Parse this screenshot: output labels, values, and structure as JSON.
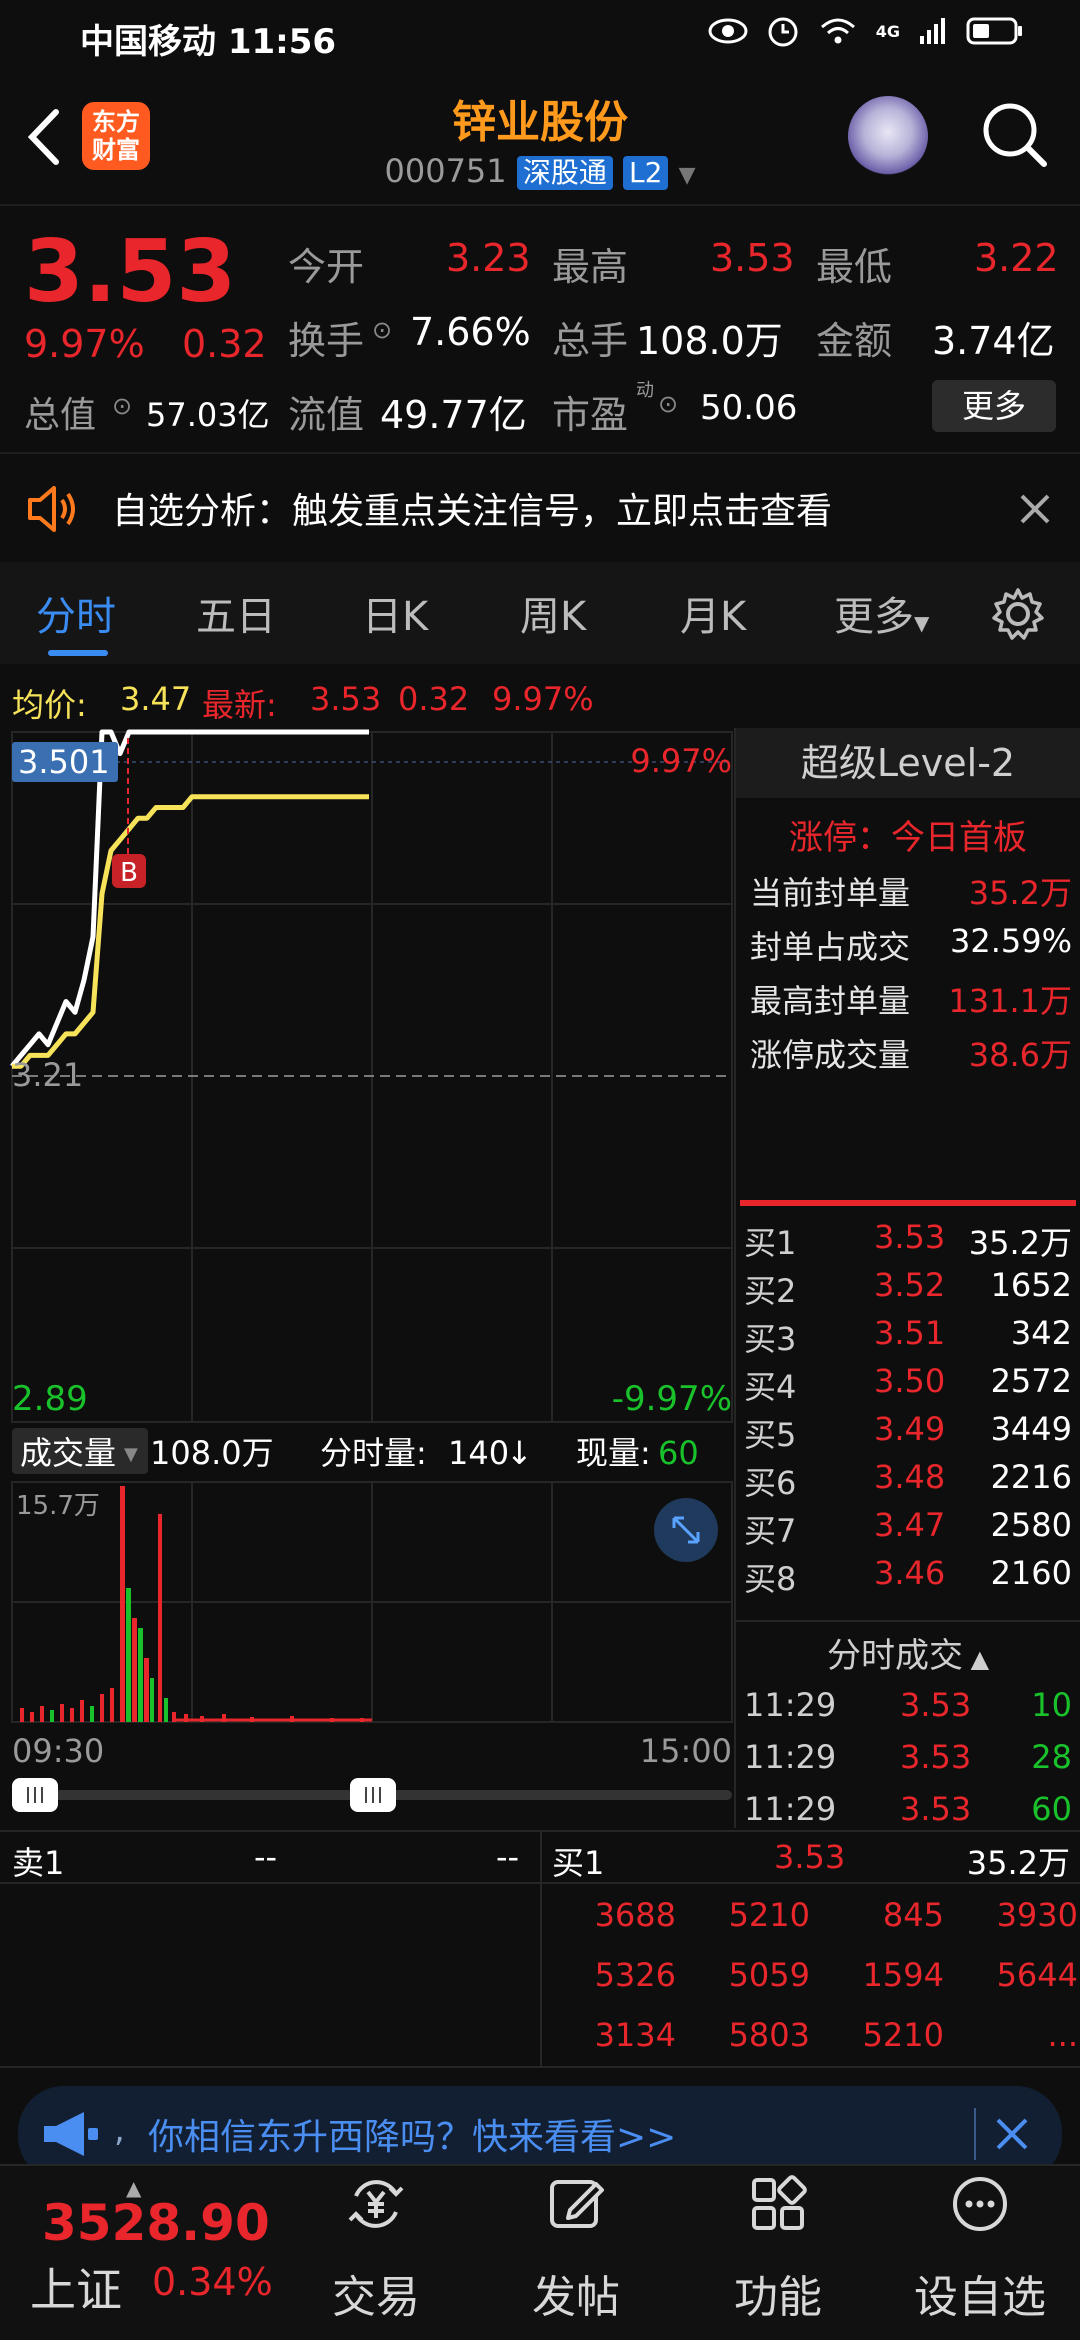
{
  "status_bar": {
    "carrier_time": "中国移动 11:56",
    "network": "4G"
  },
  "header": {
    "logo_text": "东方财富",
    "stock_name": "锌业股份",
    "stock_code": "000751",
    "tag_sz": "深股通",
    "tag_l2": "L2"
  },
  "quote": {
    "price": "3.53",
    "pct": "9.97%",
    "change": "0.32",
    "open_label": "今开",
    "open": "3.23",
    "high_label": "最高",
    "high": "3.53",
    "low_label": "最低",
    "low": "3.22",
    "turnover_label": "换手",
    "turnover": "7.66%",
    "volume_label": "总手",
    "volume": "108.0万",
    "amount_label": "金额",
    "amount": "3.74亿",
    "mcap_label": "总值",
    "mcap": "57.03亿",
    "float_label": "流值",
    "float": "49.77亿",
    "pe_label": "市盈",
    "pe_super": "动",
    "pe": "50.06",
    "more_button": "更多"
  },
  "notice": {
    "text": "自选分析：触发重点关注信号，立即点击查看"
  },
  "tabs": [
    "分时",
    "五日",
    "日K",
    "周K",
    "月K",
    "更多"
  ],
  "chart_header": {
    "avg_label": "均价:",
    "avg": "3.47",
    "latest_label": "最新:",
    "latest": "3.53",
    "chg": "0.32",
    "pct": "9.97%"
  },
  "chart_axes": {
    "cursor_price": "3.501",
    "top_pct": "9.97%",
    "mid_price": "3.21",
    "bottom_price": "2.89",
    "bottom_pct": "-9.97%",
    "b_marker": "B"
  },
  "volume_header": {
    "label": "成交量",
    "total": "108.0万",
    "minute_label": "分时量:",
    "minute_value": "140",
    "now_label": "现量:",
    "now_value": "60",
    "max": "15.7万"
  },
  "time_axis": {
    "start": "09:30",
    "end": "15:00"
  },
  "chart_data": {
    "type": "line",
    "x": [
      "09:30",
      "09:33",
      "09:36",
      "09:39",
      "09:42",
      "09:45",
      "09:48",
      "09:51",
      "09:54",
      "09:57",
      "10:00",
      "10:03",
      "10:06",
      "10:09",
      "10:12",
      "10:15",
      "10:18",
      "10:21",
      "10:24",
      "10:27",
      "10:30",
      "10:45",
      "11:00",
      "11:15",
      "11:29"
    ],
    "series": [
      {
        "values": [
          3.22,
          3.23,
          3.24,
          3.25,
          3.24,
          3.26,
          3.28,
          3.27,
          3.3,
          3.34,
          3.53,
          3.53,
          3.51,
          3.53,
          3.53,
          3.53,
          3.53,
          3.53,
          3.53,
          3.53,
          3.53,
          3.53,
          3.53,
          3.53,
          3.53
        ],
        "color": "#ffffff"
      },
      {
        "values": [
          3.22,
          3.22,
          3.23,
          3.23,
          3.23,
          3.24,
          3.25,
          3.25,
          3.26,
          3.27,
          3.38,
          3.42,
          3.43,
          3.44,
          3.45,
          3.45,
          3.46,
          3.46,
          3.46,
          3.46,
          3.47,
          3.47,
          3.47,
          3.47,
          3.47
        ],
        "color": "#f7e35a"
      }
    ],
    "ylim": [
      2.89,
      3.53
    ]
  },
  "level2": {
    "title": "超级Level-2",
    "limit_title": "涨停：今日首板",
    "stats": [
      {
        "label": "当前封单量",
        "value": "35.2万",
        "color": "red"
      },
      {
        "label": "封单占成交",
        "value": "32.59%",
        "color": "white"
      },
      {
        "label": "最高封单量",
        "value": "131.1万",
        "color": "red"
      },
      {
        "label": "涨停成交量",
        "value": "38.6万",
        "color": "red"
      }
    ],
    "bids": [
      {
        "label": "买1",
        "price": "3.53",
        "vol": "35.2万"
      },
      {
        "label": "买2",
        "price": "3.52",
        "vol": "1652"
      },
      {
        "label": "买3",
        "price": "3.51",
        "vol": "342"
      },
      {
        "label": "买4",
        "price": "3.50",
        "vol": "2572"
      },
      {
        "label": "买5",
        "price": "3.49",
        "vol": "3449"
      },
      {
        "label": "买6",
        "price": "3.48",
        "vol": "2216"
      },
      {
        "label": "买7",
        "price": "3.47",
        "vol": "2580"
      },
      {
        "label": "买8",
        "price": "3.46",
        "vol": "2160"
      }
    ],
    "trades_title": "分时成交",
    "trades": [
      {
        "time": "11:29",
        "price": "3.53",
        "vol": "10"
      },
      {
        "time": "11:29",
        "price": "3.53",
        "vol": "28"
      },
      {
        "time": "11:29",
        "price": "3.53",
        "vol": "60"
      }
    ]
  },
  "book": {
    "sell_label": "卖1",
    "sell_price": "--",
    "sell_vol": "--",
    "buy_label": "买1",
    "buy_price": "3.53",
    "buy_vol": "35.2万",
    "queue": [
      [
        "3688",
        "5210",
        "845",
        "3930"
      ],
      [
        "5326",
        "5059",
        "1594",
        "5644"
      ],
      [
        "3134",
        "5803",
        "5210",
        "..."
      ]
    ]
  },
  "ad": {
    "text": "你相信东升西降吗？快来看看>>"
  },
  "bottom_nav": {
    "index_value": "3528.90",
    "index_name": "上证",
    "index_pct": "0.34%",
    "items": [
      "交易",
      "发帖",
      "功能",
      "设自选"
    ]
  }
}
